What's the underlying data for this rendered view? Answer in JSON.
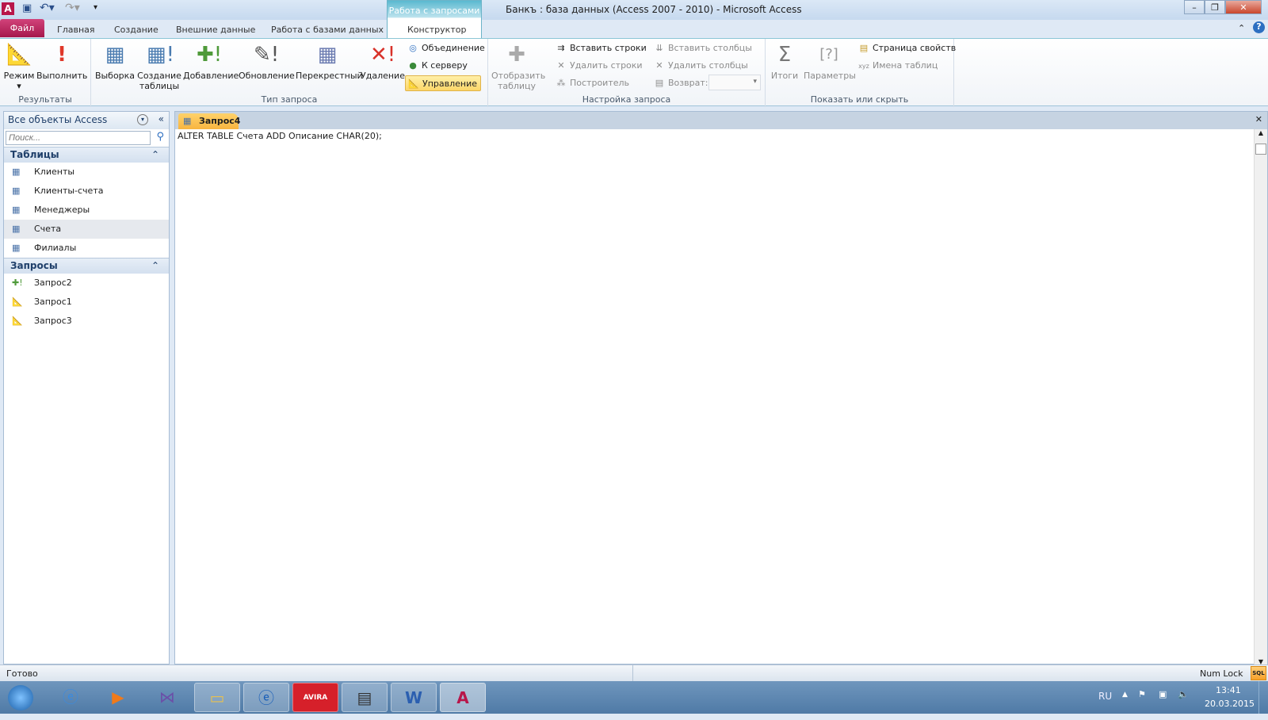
{
  "window": {
    "title": "Банкъ : база данных (Access 2007 - 2010)  -  Microsoft Access",
    "context_tab": "Работа с запросами"
  },
  "tabs": {
    "file": "Файл",
    "items": [
      "Главная",
      "Создание",
      "Внешние данные",
      "Работа с базами данных",
      "Конструктор"
    ]
  },
  "ribbon": {
    "results": {
      "label": "Результаты",
      "mode": "Режим",
      "run": "Выполнить"
    },
    "query_type": {
      "label": "Тип запроса",
      "select": "Выборка",
      "make_table_1": "Создание",
      "make_table_2": "таблицы",
      "append": "Добавление",
      "update": "Обновление",
      "crosstab": "Перекрестный",
      "delete": "Удаление",
      "union": "Объединение",
      "pass_through": "К серверу",
      "data_definition": "Управление"
    },
    "setup": {
      "label": "Настройка запроса",
      "show_table_1": "Отобразить",
      "show_table_2": "таблицу",
      "insert_rows": "Вставить строки",
      "delete_rows": "Удалить строки",
      "builder": "Построитель",
      "insert_columns": "Вставить столбцы",
      "delete_columns": "Удалить столбцы",
      "return": "Возврат:",
      "return_value": ""
    },
    "show_hide": {
      "label": "Показать или скрыть",
      "totals": "Итоги",
      "parameters": "Параметры",
      "property_sheet": "Страница свойств",
      "table_names": "Имена таблиц"
    }
  },
  "nav": {
    "title": "Все объекты Access",
    "search_placeholder": "Поиск...",
    "sections": [
      {
        "label": "Таблицы",
        "items": [
          "Клиенты",
          "Клиенты-счета",
          "Менеджеры",
          "Счета",
          "Филиалы"
        ]
      },
      {
        "label": "Запросы",
        "items": [
          "Запрос2",
          "Запрос1",
          "Запрос3"
        ]
      }
    ]
  },
  "document": {
    "tab": "Запрос4",
    "sql": "ALTER TABLE Счета ADD Описание CHAR(20);"
  },
  "status": {
    "left": "Готово",
    "numlock": "Num Lock",
    "sql_view": "SQL"
  },
  "taskbar": {
    "lang": "RU",
    "time": "13:41",
    "date": "20.03.2015",
    "avira": "AVIRA"
  }
}
